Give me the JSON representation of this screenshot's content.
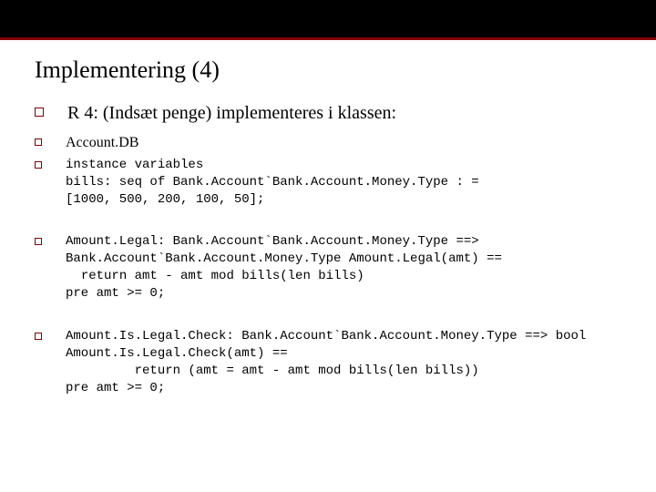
{
  "slide": {
    "title": "Implementering (4)",
    "items": [
      {
        "text": "R 4: (Indsæt penge) implementeres i klassen:",
        "style": "large"
      },
      {
        "text": "Account.DB",
        "style": "med"
      },
      {
        "text": "instance variables\nbills: seq of Bank.Account`Bank.Account.Money.Type : =\n[1000, 500, 200, 100, 50];",
        "style": "code"
      },
      {
        "text": "Amount.Legal: Bank.Account`Bank.Account.Money.Type ==>\nBank.Account`Bank.Account.Money.Type Amount.Legal(amt) ==\n  return amt - amt mod bills(len bills)\npre amt >= 0;",
        "style": "code"
      },
      {
        "text": "Amount.Is.Legal.Check: Bank.Account`Bank.Account.Money.Type ==> bool\nAmount.Is.Legal.Check(amt) ==\n         return (amt = amt - amt mod bills(len bills))\npre amt >= 0;",
        "style": "code"
      }
    ]
  }
}
